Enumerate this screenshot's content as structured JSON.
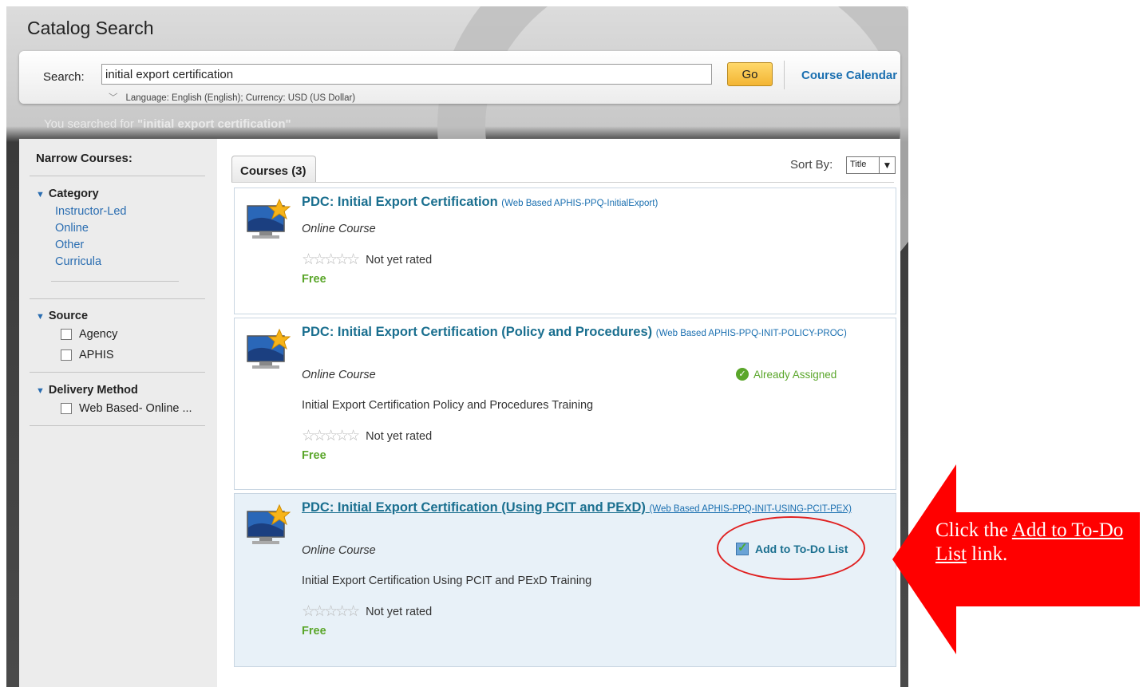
{
  "page_title": "Catalog Search",
  "search": {
    "label": "Search:",
    "value": "initial export certification",
    "go_label": "Go",
    "course_calendar_label": "Course Calendar",
    "language_currency": "Language: English (English); Currency: USD (US Dollar)"
  },
  "searched_for": {
    "prefix": "You searched for ",
    "query": "\"initial export certification\""
  },
  "sidebar": {
    "title": "Narrow Courses:",
    "category": {
      "heading": "Category",
      "items": [
        "Instructor-Led",
        "Online",
        "Other",
        "Curricula"
      ]
    },
    "source": {
      "heading": "Source",
      "items": [
        "Agency",
        "APHIS"
      ]
    },
    "delivery": {
      "heading": "Delivery Method",
      "items": [
        "Web Based- Online ..."
      ]
    }
  },
  "tabs": {
    "courses_label": "Courses (3)",
    "sort_by_label": "Sort By:",
    "sort_value": "Title"
  },
  "courses": [
    {
      "title": "PDC: Initial Export Certification",
      "code": "(Web Based APHIS-PPQ-InitialExport)",
      "type": "Online Course",
      "rating": "Not yet rated",
      "price": "Free"
    },
    {
      "title": "PDC: Initial Export Certification (Policy and Procedures)",
      "code": "(Web Based APHIS-PPQ-INIT-POLICY-PROC)",
      "type": "Online Course",
      "status": "Already Assigned",
      "description": "Initial Export Certification Policy and Procedures Training",
      "rating": "Not yet rated",
      "price": "Free"
    },
    {
      "title": "PDC: Initial Export Certification (Using PCIT and PExD)",
      "code": "(Web Based APHIS-PPQ-INIT-USING-PCIT-PEX)",
      "type": "Online Course",
      "action": "Add to To-Do List",
      "description": "Initial Export Certification Using PCIT and PExD Training",
      "rating": "Not yet rated",
      "price": "Free"
    }
  ],
  "callout": {
    "before": "Click the ",
    "link": "Add to To-Do List",
    "after": " link."
  },
  "colors": {
    "link_blue": "#1a6fb0",
    "title_teal": "#1a6f8f",
    "free_green": "#5aa62a",
    "go_yellow": "#f3b534",
    "callout_red": "#ff0000"
  }
}
